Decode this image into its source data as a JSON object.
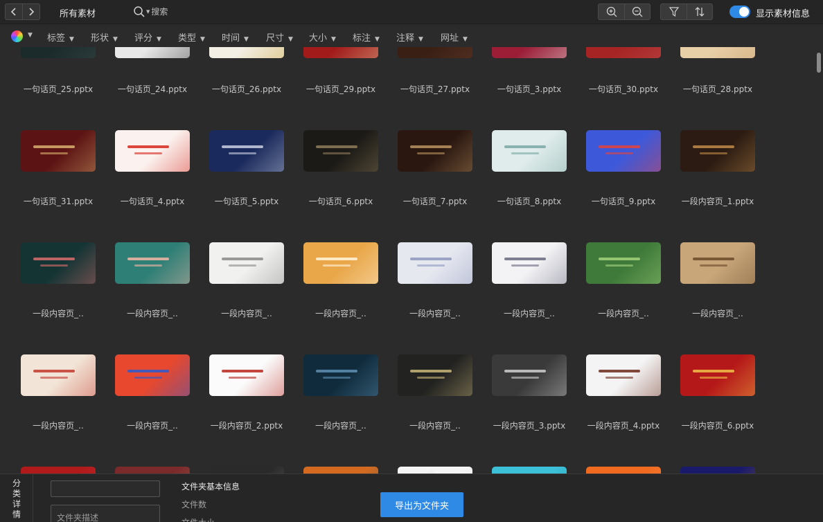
{
  "toolbar": {
    "back_icon": "chevron-left-icon",
    "forward_icon": "chevron-right-icon",
    "title": "所有素材",
    "search_placeholder": "搜索",
    "zoom_in_icon": "zoom-in-icon",
    "zoom_out_icon": "zoom-out-icon",
    "filter_icon": "funnel-icon",
    "sort_icon": "sort-icon",
    "toggle_label": "显示素材信息",
    "toggle_on": true,
    "accent": "#2f8ae5"
  },
  "filters": [
    "标签",
    "形状",
    "评分",
    "类型",
    "时间",
    "尺寸",
    "大小",
    "标注",
    "注释",
    "网址"
  ],
  "grid": {
    "rows": [
      {
        "items": [
          {
            "name": "一句话页_25.pptx",
            "bg": "#1b2a2a",
            "fg": "#3e5050"
          },
          {
            "name": "一句话页_24.pptx",
            "bg": "#e8e8e8",
            "fg": "#444"
          },
          {
            "name": "一句话页_26.pptx",
            "bg": "#f3efe4",
            "fg": "#c9a43d"
          },
          {
            "name": "一句话页_29.pptx",
            "bg": "#a11b1b",
            "fg": "#e6c89a"
          },
          {
            "name": "一句话页_27.pptx",
            "bg": "#3a1f14",
            "fg": "#6b4030"
          },
          {
            "name": "一句话页_3.pptx",
            "bg": "#9b1d36",
            "fg": "#e5e5e5"
          },
          {
            "name": "一句话页_30.pptx",
            "bg": "#a62424",
            "fg": "#c25151"
          },
          {
            "name": "一句话页_28.pptx",
            "bg": "#e8cfa8",
            "fg": "#c79b68"
          }
        ]
      },
      {
        "items": [
          {
            "name": "一句话页_31.pptx",
            "bg": "#5c1313",
            "fg": "#d8b070"
          },
          {
            "name": "一句话页_4.pptx",
            "bg": "#fbf1ee",
            "fg": "#d6281d"
          },
          {
            "name": "一句话页_5.pptx",
            "bg": "#1a2a5c",
            "fg": "#c9cfe0"
          },
          {
            "name": "一句话页_6.pptx",
            "bg": "#1c1a17",
            "fg": "#8f7c58"
          },
          {
            "name": "一句话页_7.pptx",
            "bg": "#2a1710",
            "fg": "#b99260"
          },
          {
            "name": "一句话页_8.pptx",
            "bg": "#dfeceb",
            "fg": "#7aa8a4"
          },
          {
            "name": "一句话页_9.pptx",
            "bg": "#3d59d9",
            "fg": "#e8423a"
          },
          {
            "name": "一段内容页_1.pptx",
            "bg": "#2b1b12",
            "fg": "#c08a4a"
          }
        ]
      },
      {
        "items": [
          {
            "name": "一段内容页_..",
            "bg": "#143434",
            "fg": "#d96d6d"
          },
          {
            "name": "一段内容页_..",
            "bg": "#2e7f76",
            "fg": "#f2b6a6"
          },
          {
            "name": "一段内容页_..",
            "bg": "#f1f1ef",
            "fg": "#8a8a8a"
          },
          {
            "name": "一段内容页_..",
            "bg": "#e9a74a",
            "fg": "#fff4dc"
          },
          {
            "name": "一段内容页_..",
            "bg": "#e6e8f0",
            "fg": "#8e98bd"
          },
          {
            "name": "一段内容页_..",
            "bg": "#f3f3f5",
            "fg": "#6a6a80"
          },
          {
            "name": "一段内容页_..",
            "bg": "#3f7a3a",
            "fg": "#a3d27c"
          },
          {
            "name": "一段内容页_..",
            "bg": "#c8a67a",
            "fg": "#6b4a2a"
          }
        ]
      },
      {
        "items": [
          {
            "name": "一段内容页_..",
            "bg": "#f2e4d6",
            "fg": "#c23a2e"
          },
          {
            "name": "一段内容页_..",
            "bg": "#e7482e",
            "fg": "#2a5bd0"
          },
          {
            "name": "一段内容页_2.pptx",
            "bg": "#fbfbfb",
            "fg": "#b7241c"
          },
          {
            "name": "一段内容页_..",
            "bg": "#0f2b3c",
            "fg": "#5f8fb0"
          },
          {
            "name": "一段内容页_..",
            "bg": "#222220",
            "fg": "#c9b67a"
          },
          {
            "name": "一段内容页_3.pptx",
            "bg": "#3a3a3a",
            "fg": "#cfcfcf"
          },
          {
            "name": "一段内容页_4.pptx",
            "bg": "#f4f4f4",
            "fg": "#6b2a1a"
          },
          {
            "name": "一段内容页_6.pptx",
            "bg": "#b51818",
            "fg": "#f0c24a"
          }
        ]
      },
      {
        "items": [
          {
            "name": "",
            "bg": "#b01a1a",
            "fg": "#e04040"
          },
          {
            "name": "",
            "bg": "#7a2a2a",
            "fg": "#c87a5a"
          },
          {
            "name": "",
            "bg": "#2a2a2a",
            "fg": "#888"
          },
          {
            "name": "",
            "bg": "#d46a20",
            "fg": "#1a5a6a"
          },
          {
            "name": "",
            "bg": "#f5f5f5",
            "fg": "#ddd"
          },
          {
            "name": "",
            "bg": "#3cc0d8",
            "fg": "#2a8aa8"
          },
          {
            "name": "",
            "bg": "#f06a20",
            "fg": "#f8a060"
          },
          {
            "name": "",
            "bg": "#1a1a6a",
            "fg": "#d08a2a"
          }
        ]
      }
    ]
  },
  "bottom_panel": {
    "tab_label": "分类详情",
    "folder_name_value": "",
    "folder_desc_placeholder": "文件夹描述",
    "info_title": "文件夹基本信息",
    "file_count_label": "文件数",
    "file_size_label": "文件大小",
    "export_button": "导出为文件夹"
  }
}
